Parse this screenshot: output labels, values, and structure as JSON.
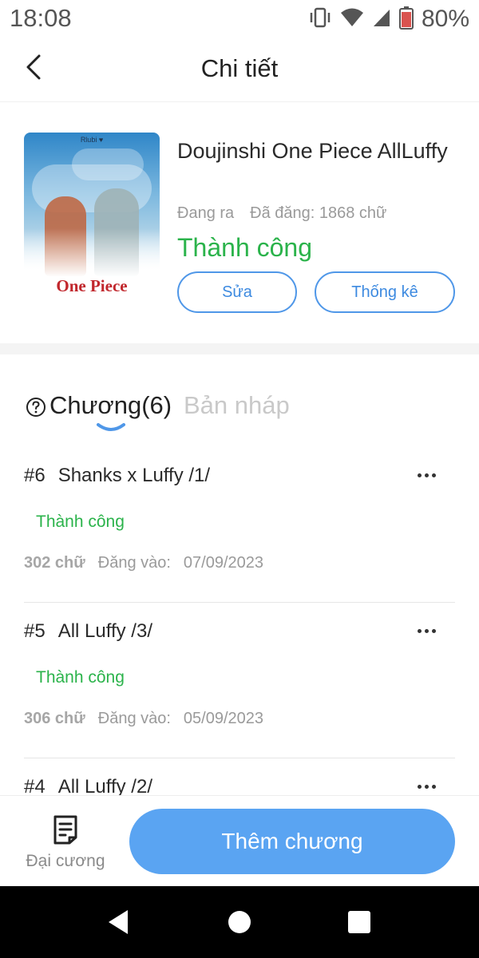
{
  "status_bar": {
    "time": "18:08",
    "battery": "80%",
    "icons": [
      "vibrate-icon",
      "wifi-icon",
      "signal-icon",
      "battery-icon"
    ]
  },
  "header": {
    "title": "Chi tiết",
    "back_icon": "chevron-left-icon"
  },
  "book": {
    "title": "Doujinshi One Piece AllLuffy",
    "state": "Đang ra",
    "published": "Đã đăng: 1868 chữ",
    "status": "Thành công",
    "cover_tag": "Rlubi ♥",
    "cover_title": "One Piece",
    "edit_label": "Sửa",
    "stats_label": "Thống kê"
  },
  "tabs": {
    "chapters_label": "Chương(6)",
    "drafts_label": "Bản nháp",
    "help_icon": "question-circle-icon"
  },
  "chapters": [
    {
      "number": "#6",
      "title": "Shanks x Luffy /1/",
      "status": "Thành công",
      "words": "302 chữ",
      "date_label": "Đăng vào:",
      "date": "07/09/2023"
    },
    {
      "number": "#5",
      "title": "All Luffy /3/",
      "status": "Thành công",
      "words": "306 chữ",
      "date_label": "Đăng vào:",
      "date": "05/09/2023"
    },
    {
      "number": "#4",
      "title": "All Luffy /2/",
      "status": "",
      "words": "",
      "date_label": "",
      "date": ""
    }
  ],
  "bottom": {
    "outline_label": "Đại cương",
    "add_label": "Thêm chương"
  },
  "colors": {
    "accent": "#5aa4f2",
    "success": "#2bb34b",
    "muted": "#9a9a9a"
  }
}
